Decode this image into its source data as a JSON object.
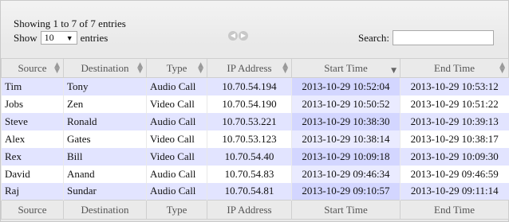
{
  "info": "Showing 1 to 7 of 7 entries",
  "length": {
    "label_before": "Show",
    "value": "10",
    "label_after": "entries"
  },
  "pager": {
    "prev": "◀",
    "next": "▶"
  },
  "search": {
    "label": "Search:",
    "value": ""
  },
  "columns": [
    "Source",
    "Destination",
    "Type",
    "IP Address",
    "Start Time",
    "End Time"
  ],
  "rows": [
    [
      "Tim",
      "Tony",
      "Audio Call",
      "10.70.54.194",
      "2013-10-29 10:52:04",
      "2013-10-29 10:53:12"
    ],
    [
      "Jobs",
      "Zen",
      "Video Call",
      "10.70.54.190",
      "2013-10-29 10:50:52",
      "2013-10-29 10:51:22"
    ],
    [
      "Steve",
      "Ronald",
      "Audio Call",
      "10.70.53.221",
      "2013-10-29 10:38:30",
      "2013-10-29 10:39:13"
    ],
    [
      "Alex",
      "Gates",
      "Video Call",
      "10.70.53.123",
      "2013-10-29 10:38:14",
      "2013-10-29 10:38:17"
    ],
    [
      "Rex",
      "Bill",
      "Video Call",
      "10.70.54.40",
      "2013-10-29 10:09:18",
      "2013-10-29 10:09:30"
    ],
    [
      "David",
      "Anand",
      "Audio Call",
      "10.70.54.83",
      "2013-10-29 09:46:34",
      "2013-10-29 09:46:59"
    ],
    [
      "Raj",
      "Sundar",
      "Audio Call",
      "10.70.54.81",
      "2013-10-29 09:10:57",
      "2013-10-29 09:11:14"
    ]
  ],
  "sorted_column": "Start Time",
  "sort_direction": "descending"
}
